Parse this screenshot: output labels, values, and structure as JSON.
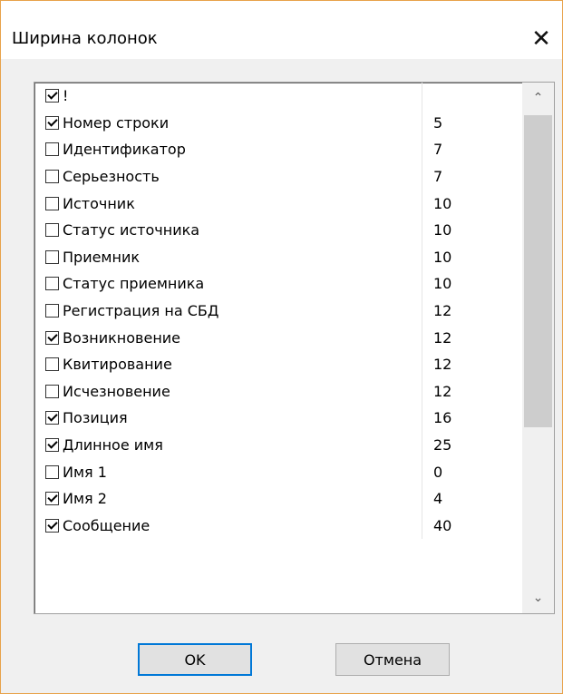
{
  "dialog": {
    "title": "Ширина колонок",
    "close_glyph": "✕"
  },
  "columns": [
    {
      "label": "!",
      "width": "",
      "checked": true
    },
    {
      "label": "Номер строки",
      "width": "5",
      "checked": true
    },
    {
      "label": "Идентификатор",
      "width": "7",
      "checked": false
    },
    {
      "label": "Серьезность",
      "width": "7",
      "checked": false
    },
    {
      "label": "Источник",
      "width": "10",
      "checked": false
    },
    {
      "label": "Статус источника",
      "width": "10",
      "checked": false
    },
    {
      "label": "Приемник",
      "width": "10",
      "checked": false
    },
    {
      "label": "Статус приемника",
      "width": "10",
      "checked": false
    },
    {
      "label": "Регистрация на СБД",
      "width": "12",
      "checked": false
    },
    {
      "label": "Возникновение",
      "width": "12",
      "checked": true
    },
    {
      "label": "Квитирование",
      "width": "12",
      "checked": false
    },
    {
      "label": "Исчезновение",
      "width": "12",
      "checked": false
    },
    {
      "label": "Позиция",
      "width": "16",
      "checked": true
    },
    {
      "label": "Длинное имя",
      "width": "25",
      "checked": true
    },
    {
      "label": "Имя 1",
      "width": "0",
      "checked": false
    },
    {
      "label": "Имя 2",
      "width": "4",
      "checked": true
    },
    {
      "label": "Сообщение",
      "width": "40",
      "checked": true
    }
  ],
  "scrollbar": {
    "up_glyph": "⌃",
    "down_glyph": "⌄"
  },
  "buttons": {
    "ok": "OK",
    "cancel": "Отмена"
  },
  "colors": {
    "window_border": "#e8a24a",
    "ok_focus": "#0078d7"
  }
}
